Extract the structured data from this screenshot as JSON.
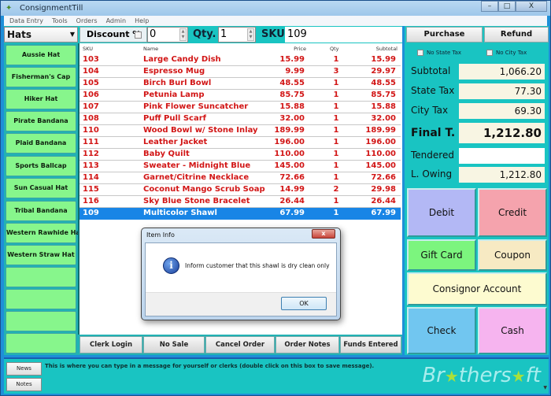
{
  "window": {
    "title": "ConsignmentTill",
    "controls": {
      "minimize": "–",
      "maximize": "□",
      "close": "X"
    }
  },
  "menu": [
    "Data Entry",
    "Tools",
    "Orders",
    "Admin",
    "Help"
  ],
  "toolbar": {
    "category": "Hats",
    "discount_label": "Discount %",
    "discount_checked": false,
    "discount_value": "0",
    "qty_label": "Qty.",
    "qty_value": "1",
    "sku_label": "SKU",
    "sku_value": "109"
  },
  "sidebar": {
    "items": [
      "Aussie Hat",
      "Fisherman's Cap",
      "Hiker Hat",
      "Pirate Bandana",
      "Plaid Bandana",
      "Sports Ballcap",
      "Sun Casual Hat",
      "Tribal Bandana",
      "Western Rawhide Hat",
      "Western Straw Hat",
      "",
      "",
      "",
      ""
    ]
  },
  "table": {
    "columns": {
      "sku": "SKU",
      "name": "Name",
      "price": "Price",
      "qty": "Qty",
      "subtotal": "Subtotal"
    },
    "rows": [
      {
        "sku": "103",
        "name": "Large Candy Dish",
        "price": "15.99",
        "qty": "1",
        "subtotal": "15.99"
      },
      {
        "sku": "104",
        "name": "Espresso Mug",
        "price": "9.99",
        "qty": "3",
        "subtotal": "29.97"
      },
      {
        "sku": "105",
        "name": "Birch Burl Bowl",
        "price": "48.55",
        "qty": "1",
        "subtotal": "48.55"
      },
      {
        "sku": "106",
        "name": "Petunia Lamp",
        "price": "85.75",
        "qty": "1",
        "subtotal": "85.75"
      },
      {
        "sku": "107",
        "name": "Pink Flower Suncatcher",
        "price": "15.88",
        "qty": "1",
        "subtotal": "15.88"
      },
      {
        "sku": "108",
        "name": "Puff Pull Scarf",
        "price": "32.00",
        "qty": "1",
        "subtotal": "32.00"
      },
      {
        "sku": "110",
        "name": "Wood Bowl w/ Stone Inlay",
        "price": "189.99",
        "qty": "1",
        "subtotal": "189.99"
      },
      {
        "sku": "111",
        "name": "Leather Jacket",
        "price": "196.00",
        "qty": "1",
        "subtotal": "196.00"
      },
      {
        "sku": "112",
        "name": "Baby Quilt",
        "price": "110.00",
        "qty": "1",
        "subtotal": "110.00"
      },
      {
        "sku": "113",
        "name": "Sweater - Midnight Blue",
        "price": "145.00",
        "qty": "1",
        "subtotal": "145.00"
      },
      {
        "sku": "114",
        "name": "Garnet/Citrine Necklace",
        "price": "72.66",
        "qty": "1",
        "subtotal": "72.66"
      },
      {
        "sku": "115",
        "name": "Coconut Mango Scrub Soap",
        "price": "14.99",
        "qty": "2",
        "subtotal": "29.98"
      },
      {
        "sku": "116",
        "name": "Sky Blue Stone Bracelet",
        "price": "26.44",
        "qty": "1",
        "subtotal": "26.44"
      },
      {
        "sku": "109",
        "name": "Multicolor Shawl",
        "price": "67.99",
        "qty": "1",
        "subtotal": "67.99",
        "selected": true
      }
    ]
  },
  "actions": [
    "Clerk Login",
    "No Sale",
    "Cancel Order",
    "Order Notes",
    "Funds Entered"
  ],
  "right_panel": {
    "purchase": "Purchase",
    "refund": "Refund",
    "no_state_tax": "No State Tax",
    "no_city_tax": "No City Tax",
    "summary": {
      "subtotal_label": "Subtotal",
      "subtotal": "1,066.20",
      "state_tax_label": "State Tax",
      "state_tax": "77.30",
      "city_tax_label": "City Tax",
      "city_tax": "69.30",
      "final_label": "Final T.",
      "final": "1,212.80",
      "tendered_label": "Tendered",
      "tendered": "",
      "owing_label": "L. Owing",
      "owing": "1,212.80"
    },
    "payments": {
      "debit": "Debit",
      "credit": "Credit",
      "gift_card": "Gift Card",
      "coupon": "Coupon",
      "consignor": "Consignor Account",
      "check": "Check",
      "cash": "Cash"
    },
    "colors": {
      "debit": "#b3b8f5",
      "credit": "#f5a3ad",
      "gift_card": "#7cf57e",
      "coupon": "#f7eac3",
      "consignor": "#fdfbd0",
      "check": "#71c6f0",
      "cash": "#f6b4ef"
    }
  },
  "news": {
    "news_button": "News",
    "notes_button": "Notes",
    "message": "This is where you can type in a message for yourself or clerks (double click on this box to save message)."
  },
  "dialog": {
    "title": "Item Info",
    "close": "x",
    "icon": "i",
    "message": "Inform customer that this shawl is dry clean only",
    "ok": "OK"
  },
  "watermark": {
    "prefix": "Br",
    "mid": "thers",
    "suffix": "ft",
    "star": "★"
  }
}
